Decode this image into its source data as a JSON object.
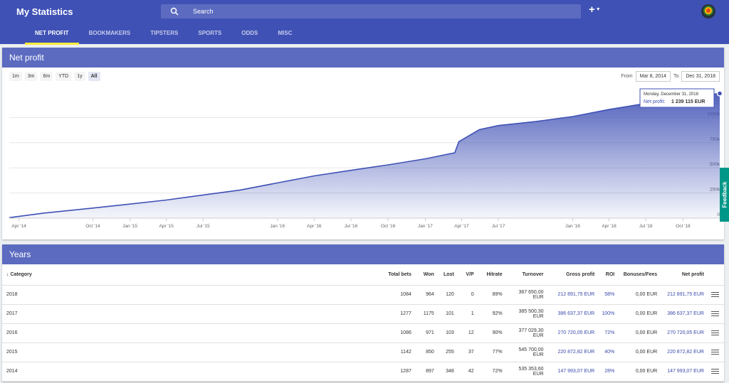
{
  "app": {
    "title": "My Statistics"
  },
  "search": {
    "label": "Search"
  },
  "nav": {
    "add_label": "+",
    "tabs": [
      "NET PROFIT",
      "BOOKMAKERS",
      "TIPSTERS",
      "SPORTS",
      "ODDS",
      "MISC"
    ],
    "active": "NET PROFIT"
  },
  "net_profit": {
    "title": "Net profit",
    "ranges": [
      "1m",
      "3m",
      "6m",
      "YTD",
      "1y",
      "All"
    ],
    "selected_range": "All",
    "from_label": "From",
    "from": "Mar 8, 2014",
    "to_label": "To",
    "to": "Dec 31, 2018",
    "tooltip": {
      "date": "Monday, December 31, 2018",
      "label": "Net profit:",
      "value": "1 239 115 EUR"
    }
  },
  "feedback": {
    "label": "Feedback"
  },
  "chart_data": {
    "type": "area",
    "x_tick_labels": [
      "Apr '14",
      "Oct '14",
      "Jan '15",
      "Apr '15",
      "Jul '15",
      "Jan '16",
      "Apr '16",
      "Jul '16",
      "Oct '16",
      "Jan '17",
      "Apr '17",
      "Jul '17",
      "Jan '18",
      "Apr '18",
      "Jul '18",
      "Oct '18"
    ],
    "y_tick_labels": [
      "0",
      "250k",
      "500k",
      "750k",
      "1000k"
    ],
    "ylim": [
      0,
      1250000
    ],
    "x": [
      "2014-03-08",
      "2014-06-01",
      "2014-10-01",
      "2015-01-01",
      "2015-04-01",
      "2015-07-01",
      "2015-10-01",
      "2016-01-01",
      "2016-04-01",
      "2016-07-01",
      "2016-10-01",
      "2017-01-01",
      "2017-03-15",
      "2017-03-25",
      "2017-05-15",
      "2017-07-01",
      "2017-10-01",
      "2018-01-01",
      "2018-04-01",
      "2018-07-01",
      "2018-10-01",
      "2018-12-31"
    ],
    "y": [
      5000,
      50000,
      100000,
      140000,
      180000,
      230000,
      280000,
      350000,
      420000,
      475000,
      530000,
      590000,
      650000,
      760000,
      880000,
      920000,
      960000,
      1010000,
      1080000,
      1140000,
      1200000,
      1239115
    ],
    "grid": true,
    "series": [
      {
        "name": "Net profit"
      }
    ]
  },
  "years": {
    "title": "Years",
    "columns": [
      "Category",
      "Total bets",
      "Won",
      "Lost",
      "V/P",
      "Hitrate",
      "Turnover",
      "Gross profit",
      "ROI",
      "Bonuses/Fees",
      "Net profit"
    ],
    "rows": [
      [
        "2018",
        "1084",
        "964",
        "120",
        "0",
        "89%",
        "367 650,00 EUR",
        "212 891,75 EUR",
        "58%",
        "0,00 EUR",
        "212 891,75 EUR"
      ],
      [
        "2017",
        "1277",
        "1175",
        "101",
        "1",
        "92%",
        "385 500,30 EUR",
        "386 637,37 EUR",
        "100%",
        "0,00 EUR",
        "386 637,37 EUR"
      ],
      [
        "2016",
        "1086",
        "971",
        "103",
        "12",
        "90%",
        "377 029,30 EUR",
        "270 720,05 EUR",
        "72%",
        "0,00 EUR",
        "270 720,05 EUR"
      ],
      [
        "2015",
        "1142",
        "850",
        "255",
        "37",
        "77%",
        "545 700,00 EUR",
        "220 872,82 EUR",
        "40%",
        "0,00 EUR",
        "220 872,82 EUR"
      ],
      [
        "2014",
        "1287",
        "897",
        "348",
        "42",
        "72%",
        "535 353,60 EUR",
        "147 993,07 EUR",
        "28%",
        "0,00 EUR",
        "147 993,07 EUR"
      ]
    ]
  },
  "colors": {
    "header": "#3f51b5",
    "card_header": "#5c6bc0",
    "series": "#3f51b5",
    "link": "#3949ab",
    "feedback": "#009688"
  }
}
